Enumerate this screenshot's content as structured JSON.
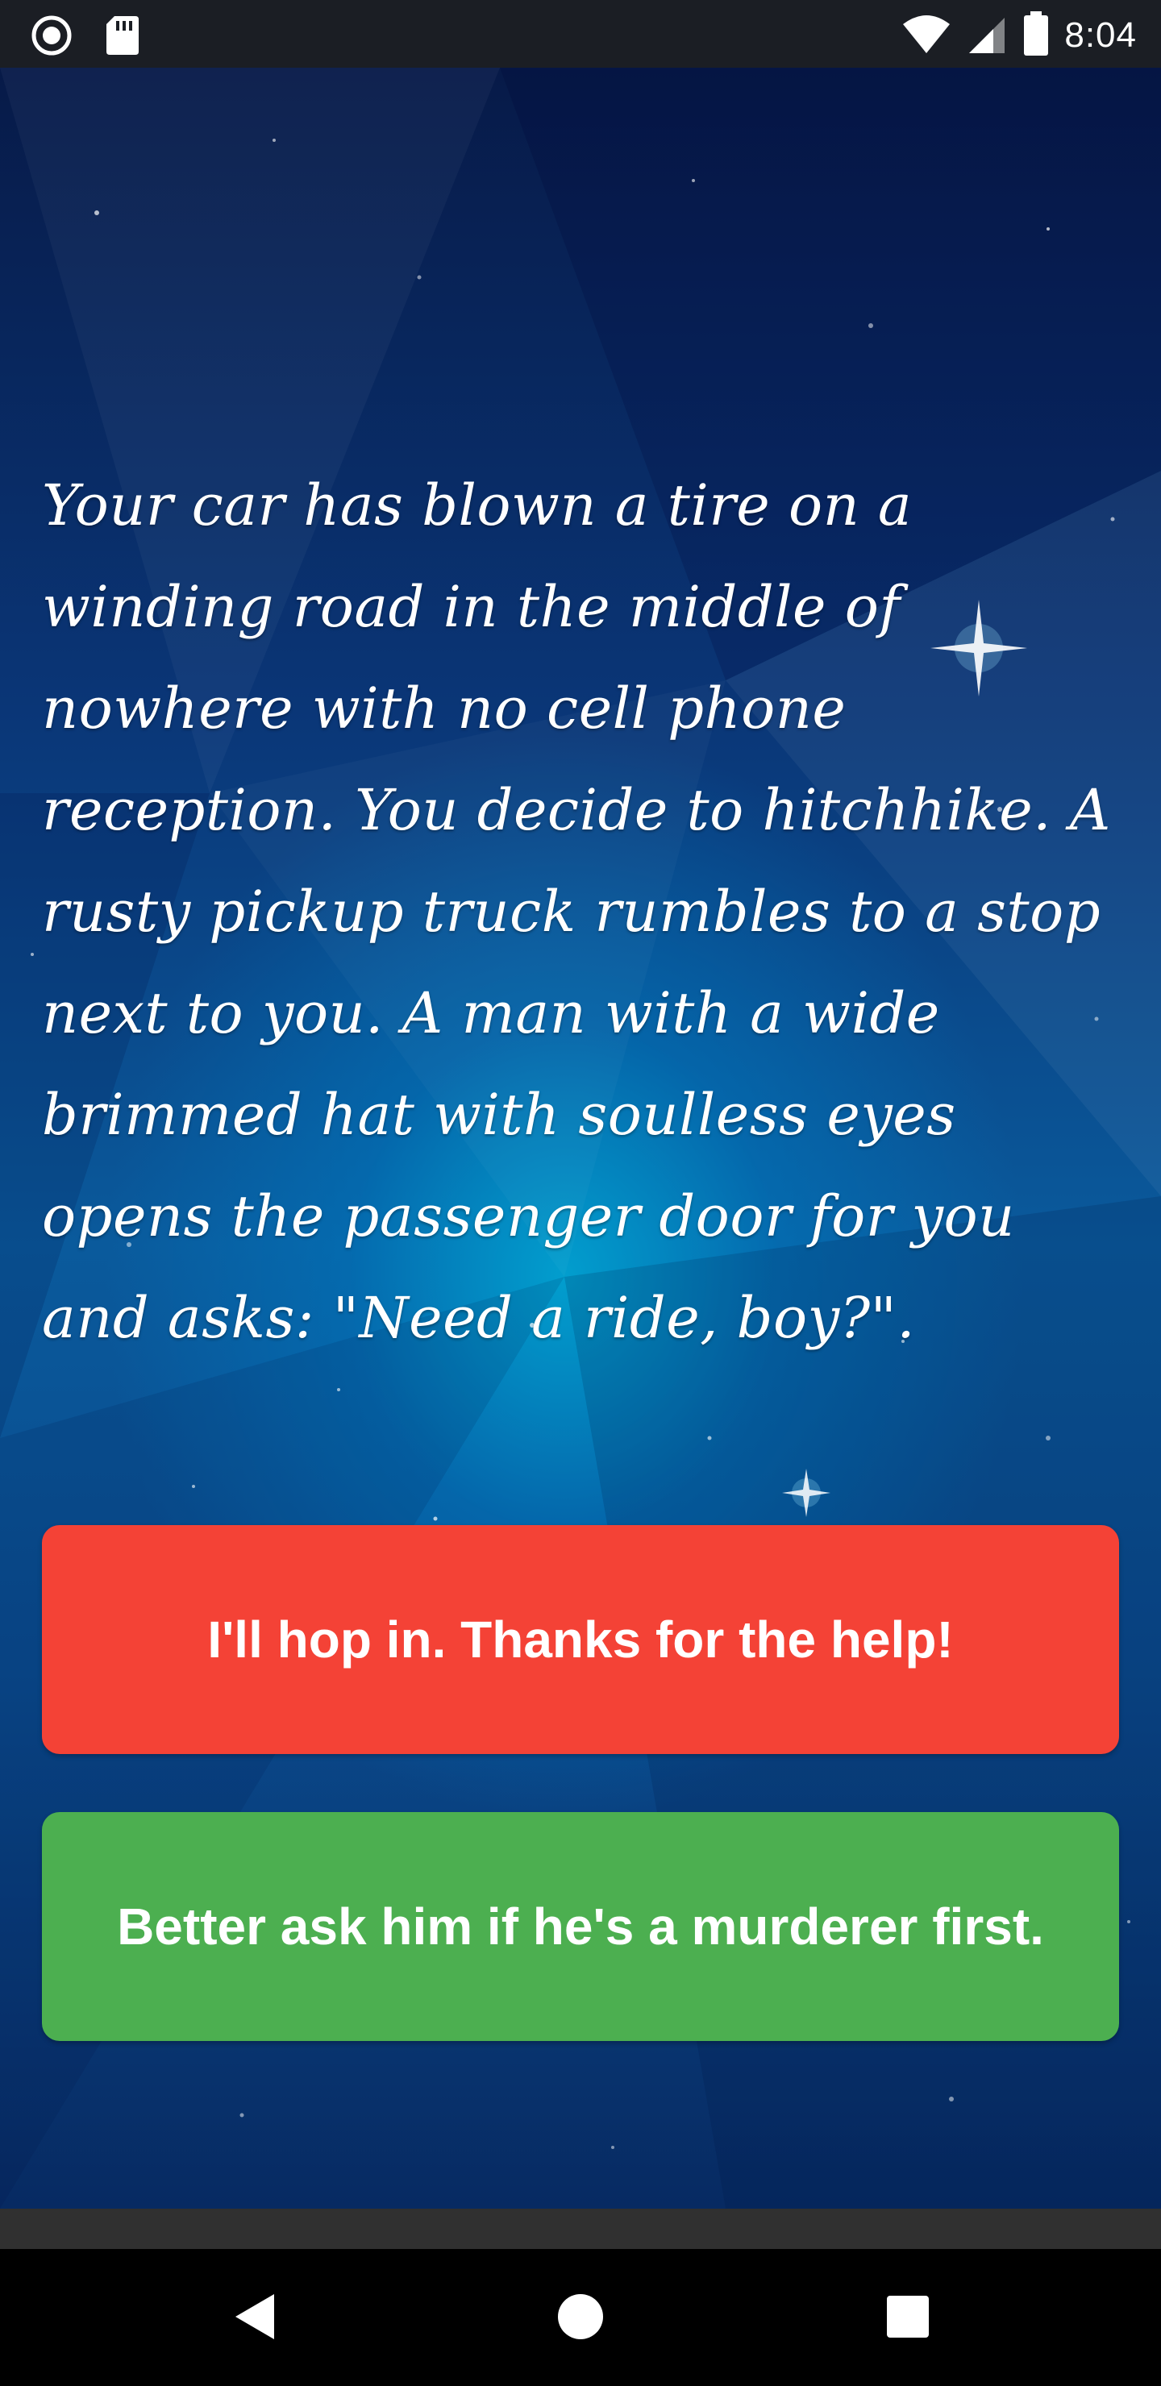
{
  "status_bar": {
    "time": "8:04",
    "icons": [
      "record-icon",
      "sd-card-icon",
      "wifi-icon",
      "signal-icon",
      "battery-icon"
    ]
  },
  "story": {
    "text": "Your car has blown a tire on a winding road in the middle of nowhere with no cell phone reception. You decide to hitchhike. A rusty pickup truck rumbles to a stop next to you. A man with a wide brimmed hat with soulless eyes opens the passenger door for you and asks: \"Need a ride, boy?\"."
  },
  "choices": [
    {
      "label": "I'll hop in. Thanks for the help!",
      "color": "#f44236"
    },
    {
      "label": "Better ask him if he's a murderer first.",
      "color": "#4caf50"
    }
  ],
  "nav_bar": {
    "icons": [
      "back-icon",
      "home-icon",
      "recents-icon"
    ]
  },
  "colors": {
    "background_top": "#071a48",
    "background_center": "#00aad7",
    "status_bar": "#1b1e24",
    "nav_bar": "#000000"
  }
}
